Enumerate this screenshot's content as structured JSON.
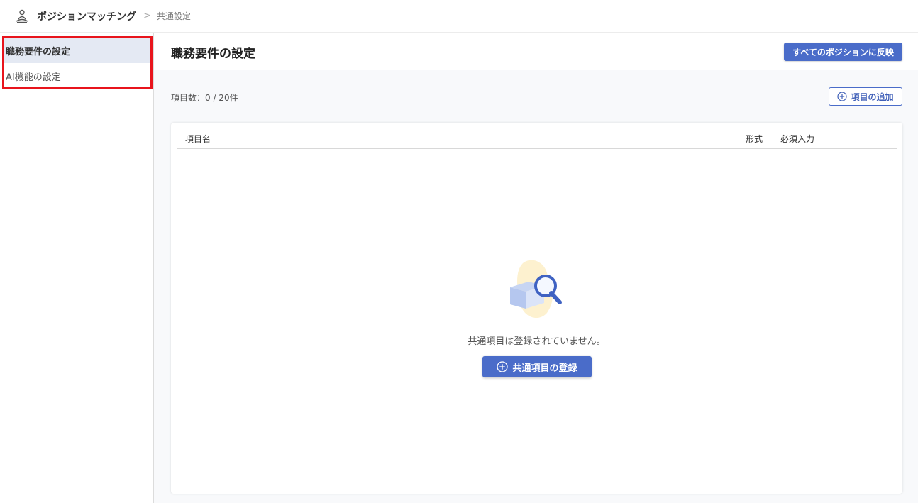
{
  "header": {
    "app_title": "ポジションマッチング",
    "breadcrumb_separator": ">",
    "breadcrumb_current": "共通設定",
    "app_icon": "person-meditation-icon"
  },
  "sidebar": {
    "items": [
      {
        "label": "職務要件の設定",
        "active": true
      },
      {
        "label": "AI機能の設定",
        "active": false
      }
    ]
  },
  "main": {
    "title": "職務要件の設定",
    "apply_all_label": "すべてのポジションに反映",
    "count_label": "項目数：0 / 20件",
    "add_item_label": "項目の追加",
    "table": {
      "columns": [
        "項目名",
        "形式",
        "必須入力"
      ]
    },
    "empty": {
      "message": "共通項目は登録されていません。",
      "register_label": "共通項目の登録",
      "illustration": "box-magnifier-icon"
    }
  },
  "colors": {
    "accent": "#4a6cc9",
    "highlight_border": "#e8141c",
    "active_bg": "#e4e9f3"
  }
}
